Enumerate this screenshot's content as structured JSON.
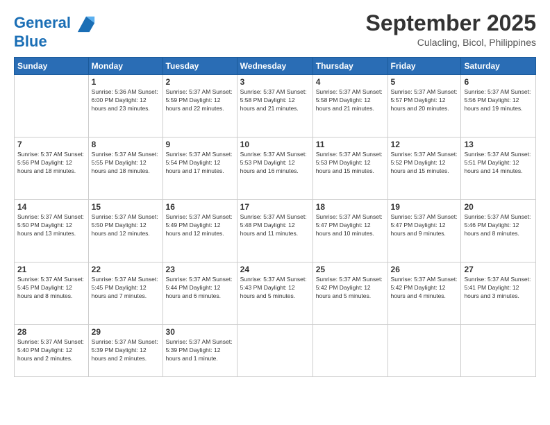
{
  "logo": {
    "line1": "General",
    "line2": "Blue"
  },
  "title": "September 2025",
  "location": "Culacling, Bicol, Philippines",
  "days_of_week": [
    "Sunday",
    "Monday",
    "Tuesday",
    "Wednesday",
    "Thursday",
    "Friday",
    "Saturday"
  ],
  "weeks": [
    [
      {
        "day": "",
        "info": ""
      },
      {
        "day": "1",
        "info": "Sunrise: 5:36 AM\nSunset: 6:00 PM\nDaylight: 12 hours\nand 23 minutes."
      },
      {
        "day": "2",
        "info": "Sunrise: 5:37 AM\nSunset: 5:59 PM\nDaylight: 12 hours\nand 22 minutes."
      },
      {
        "day": "3",
        "info": "Sunrise: 5:37 AM\nSunset: 5:58 PM\nDaylight: 12 hours\nand 21 minutes."
      },
      {
        "day": "4",
        "info": "Sunrise: 5:37 AM\nSunset: 5:58 PM\nDaylight: 12 hours\nand 21 minutes."
      },
      {
        "day": "5",
        "info": "Sunrise: 5:37 AM\nSunset: 5:57 PM\nDaylight: 12 hours\nand 20 minutes."
      },
      {
        "day": "6",
        "info": "Sunrise: 5:37 AM\nSunset: 5:56 PM\nDaylight: 12 hours\nand 19 minutes."
      }
    ],
    [
      {
        "day": "7",
        "info": "Sunrise: 5:37 AM\nSunset: 5:56 PM\nDaylight: 12 hours\nand 18 minutes."
      },
      {
        "day": "8",
        "info": "Sunrise: 5:37 AM\nSunset: 5:55 PM\nDaylight: 12 hours\nand 18 minutes."
      },
      {
        "day": "9",
        "info": "Sunrise: 5:37 AM\nSunset: 5:54 PM\nDaylight: 12 hours\nand 17 minutes."
      },
      {
        "day": "10",
        "info": "Sunrise: 5:37 AM\nSunset: 5:53 PM\nDaylight: 12 hours\nand 16 minutes."
      },
      {
        "day": "11",
        "info": "Sunrise: 5:37 AM\nSunset: 5:53 PM\nDaylight: 12 hours\nand 15 minutes."
      },
      {
        "day": "12",
        "info": "Sunrise: 5:37 AM\nSunset: 5:52 PM\nDaylight: 12 hours\nand 15 minutes."
      },
      {
        "day": "13",
        "info": "Sunrise: 5:37 AM\nSunset: 5:51 PM\nDaylight: 12 hours\nand 14 minutes."
      }
    ],
    [
      {
        "day": "14",
        "info": "Sunrise: 5:37 AM\nSunset: 5:50 PM\nDaylight: 12 hours\nand 13 minutes."
      },
      {
        "day": "15",
        "info": "Sunrise: 5:37 AM\nSunset: 5:50 PM\nDaylight: 12 hours\nand 12 minutes."
      },
      {
        "day": "16",
        "info": "Sunrise: 5:37 AM\nSunset: 5:49 PM\nDaylight: 12 hours\nand 12 minutes."
      },
      {
        "day": "17",
        "info": "Sunrise: 5:37 AM\nSunset: 5:48 PM\nDaylight: 12 hours\nand 11 minutes."
      },
      {
        "day": "18",
        "info": "Sunrise: 5:37 AM\nSunset: 5:47 PM\nDaylight: 12 hours\nand 10 minutes."
      },
      {
        "day": "19",
        "info": "Sunrise: 5:37 AM\nSunset: 5:47 PM\nDaylight: 12 hours\nand 9 minutes."
      },
      {
        "day": "20",
        "info": "Sunrise: 5:37 AM\nSunset: 5:46 PM\nDaylight: 12 hours\nand 8 minutes."
      }
    ],
    [
      {
        "day": "21",
        "info": "Sunrise: 5:37 AM\nSunset: 5:45 PM\nDaylight: 12 hours\nand 8 minutes."
      },
      {
        "day": "22",
        "info": "Sunrise: 5:37 AM\nSunset: 5:45 PM\nDaylight: 12 hours\nand 7 minutes."
      },
      {
        "day": "23",
        "info": "Sunrise: 5:37 AM\nSunset: 5:44 PM\nDaylight: 12 hours\nand 6 minutes."
      },
      {
        "day": "24",
        "info": "Sunrise: 5:37 AM\nSunset: 5:43 PM\nDaylight: 12 hours\nand 5 minutes."
      },
      {
        "day": "25",
        "info": "Sunrise: 5:37 AM\nSunset: 5:42 PM\nDaylight: 12 hours\nand 5 minutes."
      },
      {
        "day": "26",
        "info": "Sunrise: 5:37 AM\nSunset: 5:42 PM\nDaylight: 12 hours\nand 4 minutes."
      },
      {
        "day": "27",
        "info": "Sunrise: 5:37 AM\nSunset: 5:41 PM\nDaylight: 12 hours\nand 3 minutes."
      }
    ],
    [
      {
        "day": "28",
        "info": "Sunrise: 5:37 AM\nSunset: 5:40 PM\nDaylight: 12 hours\nand 2 minutes."
      },
      {
        "day": "29",
        "info": "Sunrise: 5:37 AM\nSunset: 5:39 PM\nDaylight: 12 hours\nand 2 minutes."
      },
      {
        "day": "30",
        "info": "Sunrise: 5:37 AM\nSunset: 5:39 PM\nDaylight: 12 hours\nand 1 minute."
      },
      {
        "day": "",
        "info": ""
      },
      {
        "day": "",
        "info": ""
      },
      {
        "day": "",
        "info": ""
      },
      {
        "day": "",
        "info": ""
      }
    ]
  ]
}
